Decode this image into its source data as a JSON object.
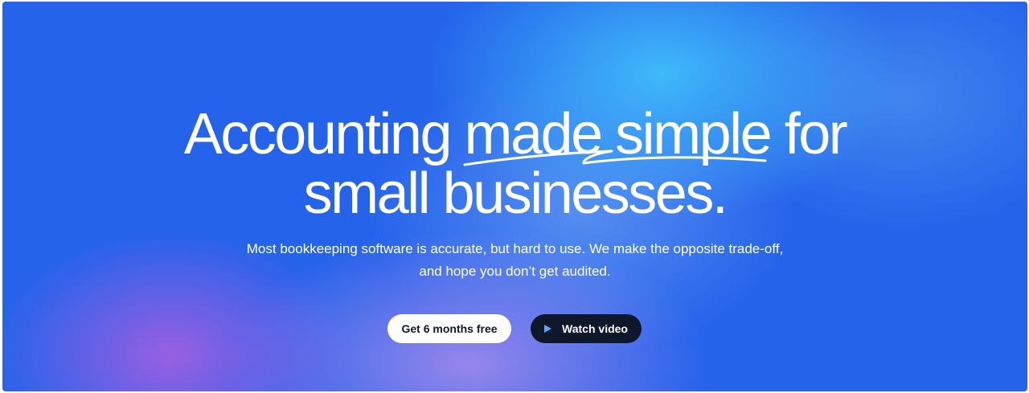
{
  "hero": {
    "headline": {
      "line1_prefix": "Accounting ",
      "line1_highlight": "made simple",
      "line1_suffix": " for",
      "line2": "small businesses."
    },
    "subheadline": "Most bookkeeping software is accurate, but hard to use. We make the opposite trade-off, and hope you don’t get audited.",
    "buttons": {
      "primary_label": "Get 6 months free",
      "secondary_label": "Watch video",
      "secondary_icon": "play-icon"
    },
    "colors": {
      "background": "#2563eb",
      "text": "#ffffff",
      "primary_button_bg": "#ffffff",
      "secondary_button_bg": "#0f172a",
      "play_icon": "#60a5fa"
    }
  }
}
